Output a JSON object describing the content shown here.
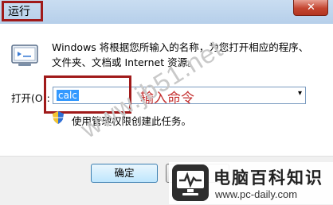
{
  "window": {
    "title": "运行",
    "close_glyph": "✕"
  },
  "dialog": {
    "description": "Windows 将根据您所输入的名称，为您打开相应的程序、文件夹、文档或 Internet 资源。",
    "open_label": "打开(O):",
    "combo_value": "calc",
    "combo_arrow": "▾",
    "annotation": "输入命令",
    "admin_notice": "使用管理权限创建此任务。",
    "ok_label": "确定"
  },
  "watermark": "www.jb51.net",
  "logo": {
    "main_text": "电脑百科知识",
    "url": "www.pc-daily.com"
  },
  "colors": {
    "highlight_box": "#a01a1a",
    "annotation_text": "#c43030",
    "selection": "#3399ff"
  }
}
